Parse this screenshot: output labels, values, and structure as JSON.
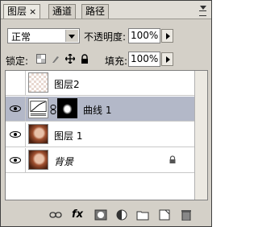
{
  "tabs": [
    {
      "label": "图层",
      "close": "×"
    },
    {
      "label": "通道"
    },
    {
      "label": "路径"
    }
  ],
  "blend_mode": {
    "value": "正常"
  },
  "opacity": {
    "label": "不透明度:",
    "value": "100%"
  },
  "lock": {
    "label": "锁定:"
  },
  "fill": {
    "label": "填充:",
    "value": "100%"
  },
  "layers": [
    {
      "name": "图层2",
      "visible": false,
      "thumb": "transparent-checker",
      "selected": false
    },
    {
      "name": "曲线 1",
      "visible": true,
      "thumb": "curves-adjustment",
      "mask": true,
      "selected": true
    },
    {
      "name": "图层 1",
      "visible": true,
      "thumb": "portrait-photo",
      "selected": false
    },
    {
      "name": "背景",
      "visible": true,
      "thumb": "portrait-photo",
      "locked": true,
      "selected": false
    }
  ],
  "bottom_icons": [
    "link-icon",
    "fx-icon",
    "add-mask-icon",
    "adjustment-layer-icon",
    "new-group-icon",
    "new-layer-icon",
    "trash-icon"
  ],
  "fx_text": "fx"
}
